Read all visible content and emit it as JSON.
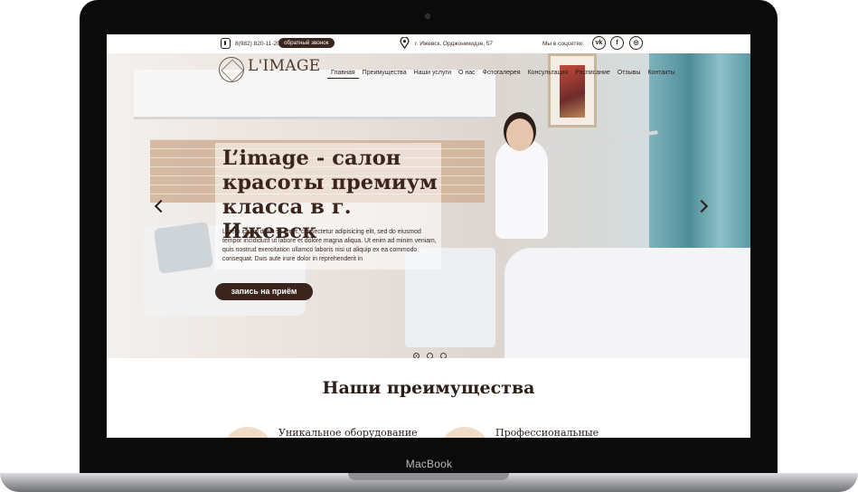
{
  "device": {
    "brand": "MacBook"
  },
  "topbar": {
    "phone": "8(982) 820-11-20",
    "callback_label": "обратный звонок",
    "address": "г. Ижевск, Орджоникидзе, 57",
    "social_label": "Мы в соцсетях:",
    "social": [
      {
        "icon": "vk-icon",
        "glyph": "vk"
      },
      {
        "icon": "facebook-icon",
        "glyph": "f"
      },
      {
        "icon": "instagram-icon",
        "glyph": "◎"
      }
    ]
  },
  "logo": {
    "text": "L'IMAGE"
  },
  "nav": {
    "items": [
      "Главная",
      "Преимущества",
      "Наши услуги",
      "О нас",
      "Фотогалерея",
      "Консультация",
      "Расписание",
      "Отзывы",
      "Контакты"
    ],
    "active": 0
  },
  "hero": {
    "title": "L’image - салон красоты премиум класса в г. Ижевск",
    "text": "Lorem ipsum dolor sit amet, consectetur adipisicing elit, sed do eiusmod tempor incididunt ut labore et dolore magna aliqua. Ut enim ad minim veniam, quis nostrud exercitation ullamco laboris nisi ut aliquip ex ea commodo consequat. Duis aute irure dolor in reprehenderit in",
    "button_label": "запись на приём",
    "slides": 3,
    "active_slide": 0
  },
  "advantages": {
    "title": "Наши преимущества",
    "items": [
      "Уникальное оборудование",
      "Профессиональные"
    ]
  },
  "colors": {
    "accent": "#3a241c",
    "text": "#2b1e18",
    "circle": "#f2dcc8"
  }
}
